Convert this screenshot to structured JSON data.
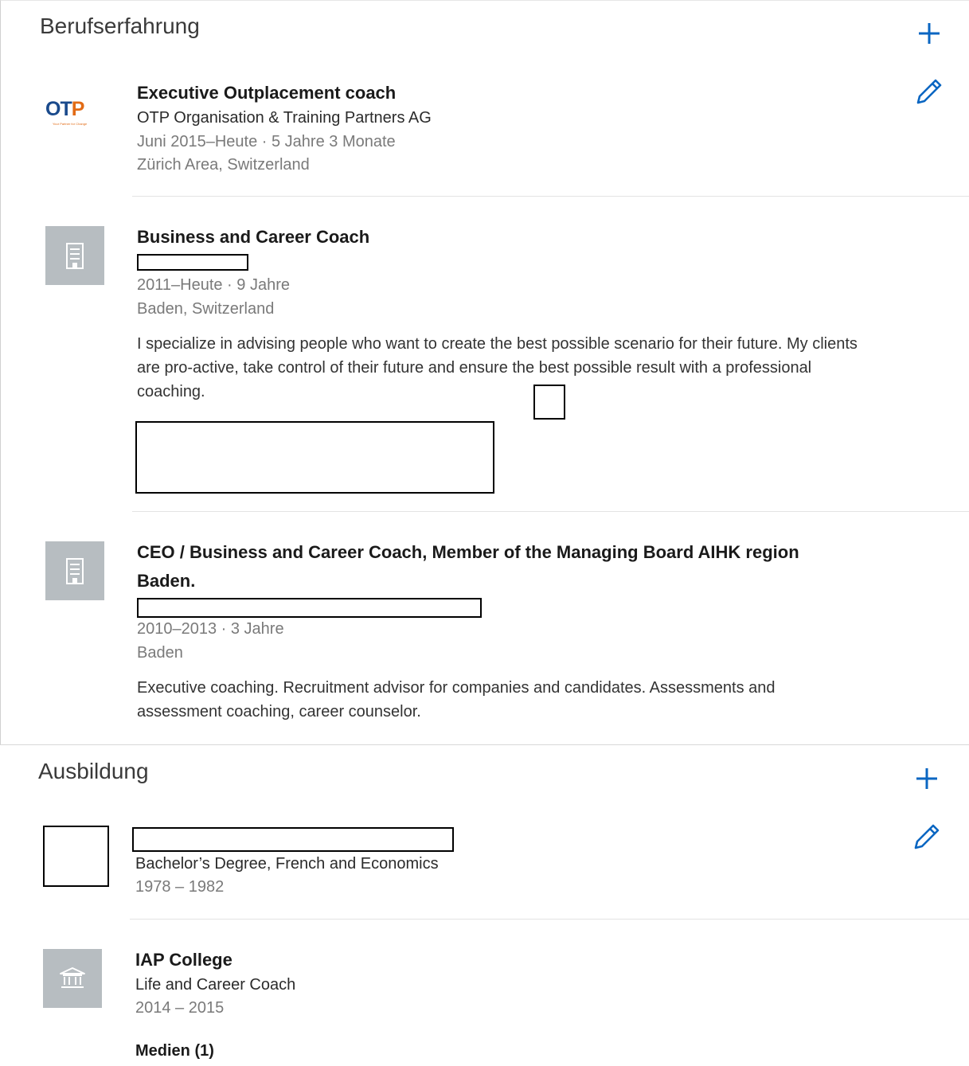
{
  "experience": {
    "title": "Berufserfahrung",
    "add_icon": "plus-icon",
    "edit_icon": "pencil-icon",
    "accent_color": "#0a66c2",
    "entries": [
      {
        "title": "Executive Outplacement coach",
        "company": "OTP Organisation & Training Partners AG",
        "dates": "Juni 2015–Heute · 5 Jahre 3 Monate",
        "location": "Zürich Area, Switzerland",
        "logo_text": "OTP",
        "logo_tagline": "Your Partner for Change"
      },
      {
        "title": "Business and Career Coach",
        "dates": "2011–Heute · 9 Jahre",
        "location": "Baden, Switzerland",
        "description": "I specialize in advising people who want to create the best possible scenario for their future. My clients are pro-active, take control of their future and ensure the best possible result with a professional coaching.",
        "logo_icon": "building-icon"
      },
      {
        "title": "CEO / Business and Career Coach, Member of the Managing Board AIHK region Baden.",
        "dates": "2010–2013 · 3 Jahre",
        "location": "Baden",
        "description": "Executive coaching. Recruitment advisor for companies and candidates. Assessments and assessment coaching, career counselor.",
        "logo_icon": "building-icon"
      }
    ]
  },
  "education": {
    "title": "Ausbildung",
    "entries": [
      {
        "degree": "Bachelor’s Degree, French and Economics",
        "dates": "1978 – 1982"
      },
      {
        "school": "IAP College",
        "degree": "Life and Career Coach",
        "dates": "2014 – 2015",
        "media": "Medien (1)",
        "logo_icon": "institution-icon"
      }
    ]
  }
}
